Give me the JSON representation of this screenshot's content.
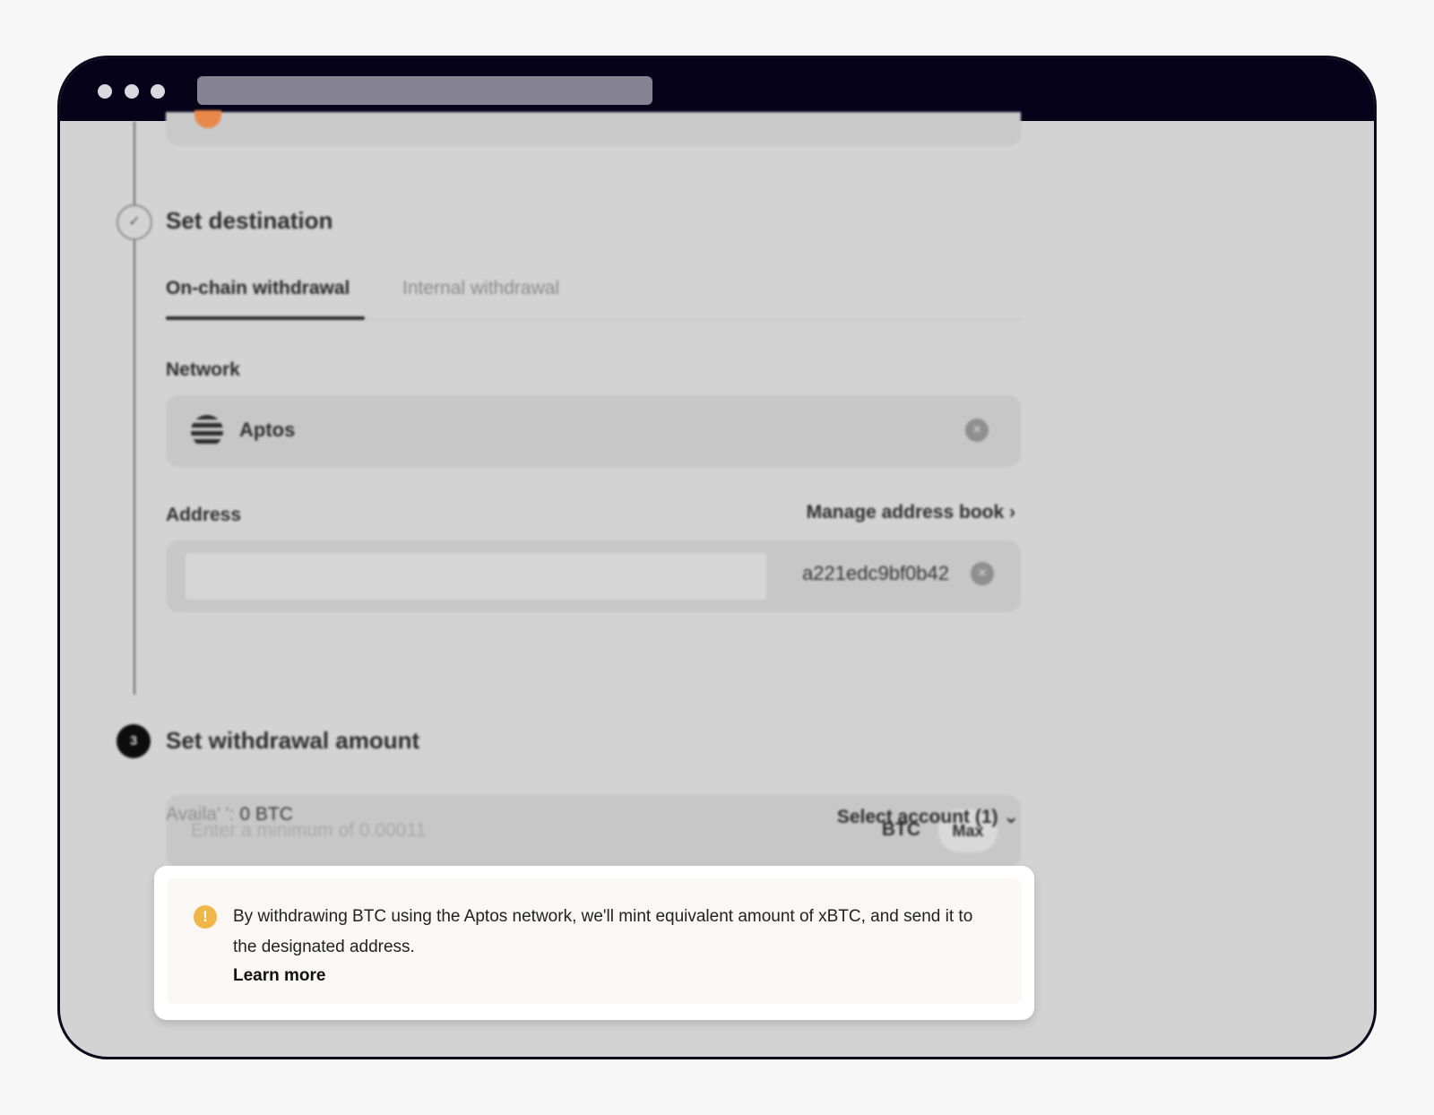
{
  "step2": {
    "title": "Set destination"
  },
  "tabs": [
    {
      "label": "On-chain withdrawal",
      "active": true
    },
    {
      "label": "Internal withdrawal",
      "active": false
    }
  ],
  "network": {
    "label": "Network",
    "value": "Aptos",
    "icon": "aptos-logo-icon"
  },
  "address": {
    "label": "Address",
    "manage_link": "Manage address book",
    "value": "a221edc9bf0b42"
  },
  "step3": {
    "number": "3",
    "title": "Set withdrawal amount"
  },
  "amount": {
    "placeholder": "Enter a minimum of 0.00011",
    "unit": "BTC",
    "max_label": "Max",
    "available_prefix": "Availa' ':",
    "available_value": "0 BTC",
    "select_account": "Select account (1)"
  },
  "notice": {
    "text": "By withdrawing BTC using the Aptos network, we'll mint equivalent amount of xBTC, and send it to the designated address.",
    "link": "Learn more"
  },
  "colors": {
    "window_bar": "#05021a",
    "warning": "#efb74a",
    "overlay": "#d3d3d3"
  }
}
